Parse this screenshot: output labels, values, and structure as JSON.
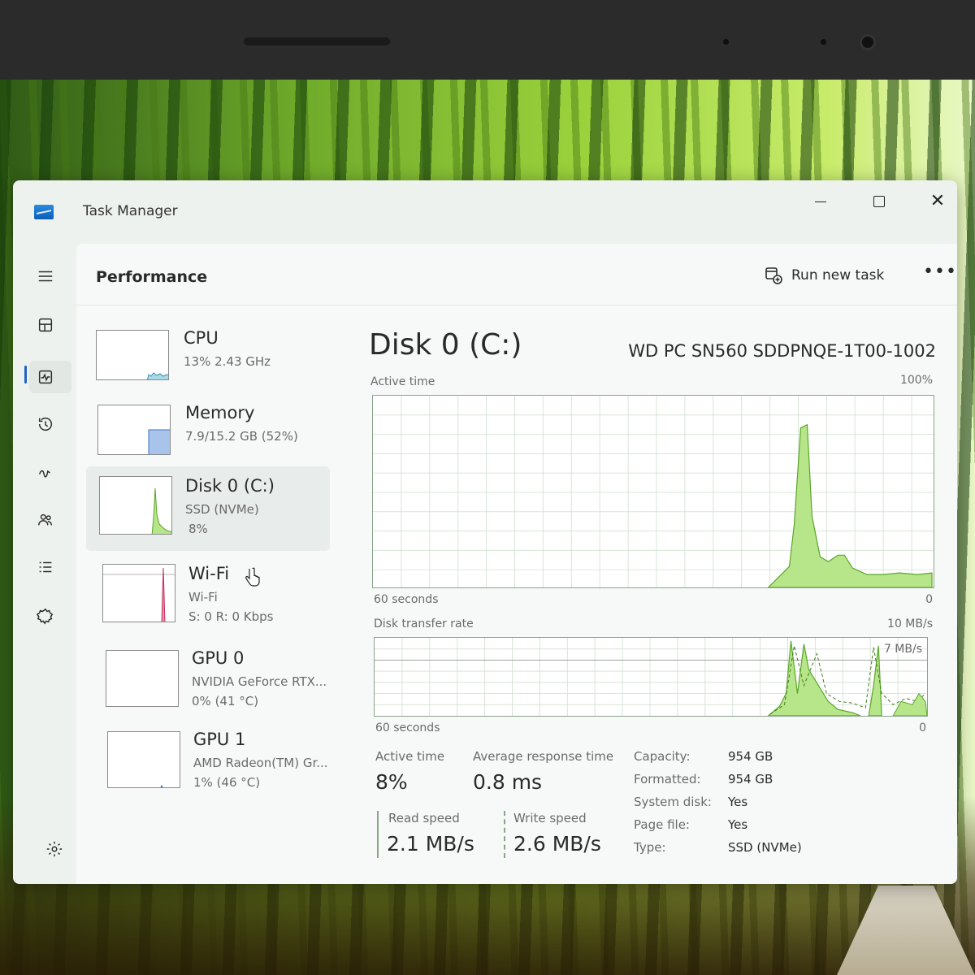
{
  "window": {
    "title": "Task Manager",
    "minimize_icon": "minimize-icon",
    "maximize_icon": "maximize-icon",
    "close_icon": "close-icon"
  },
  "rail": {
    "items": [
      {
        "icon": "hamburger-menu-icon"
      },
      {
        "icon": "processes-icon"
      },
      {
        "icon": "performance-icon"
      },
      {
        "icon": "app-history-icon"
      },
      {
        "icon": "startup-apps-icon"
      },
      {
        "icon": "users-icon"
      },
      {
        "icon": "details-icon"
      },
      {
        "icon": "services-icon"
      }
    ],
    "settings_icon": "gear-icon"
  },
  "header": {
    "title": "Performance",
    "run_new_task": "Run new task",
    "more": "•••"
  },
  "devices": [
    {
      "name": "CPU",
      "line1": "13% 2.43 GHz",
      "line2": ""
    },
    {
      "name": "Memory",
      "line1": "7.9/15.2 GB (52%)",
      "line2": ""
    },
    {
      "name": "Disk 0 (C:)",
      "line1": "SSD (NVMe)",
      "line2": "8%"
    },
    {
      "name": "Wi-Fi",
      "line1": "Wi-Fi",
      "line2": "S: 0 R: 0 Kbps"
    },
    {
      "name": "GPU 0",
      "line1": "NVIDIA GeForce RTX...",
      "line2": "0% (41 °C)"
    },
    {
      "name": "GPU 1",
      "line1": "AMD Radeon(TM) Gr...",
      "line2": "1% (46 °C)"
    }
  ],
  "detail": {
    "title": "Disk 0 (C:)",
    "model": "WD PC SN560 SDDPNQE-1T00-1002",
    "active_graph": {
      "label": "Active time",
      "max": "100%",
      "xlabel": "60 seconds",
      "min": "0"
    },
    "transfer_graph": {
      "label": "Disk transfer rate",
      "max": "10 MB/s",
      "mid": "7 MB/s",
      "xlabel": "60 seconds",
      "min": "0"
    },
    "stats": {
      "active_time_label": "Active time",
      "active_time": "8%",
      "avg_response_label": "Average response time",
      "avg_response": "0.8 ms",
      "read_label": "Read speed",
      "read": "2.1 MB/s",
      "write_label": "Write speed",
      "write": "2.6 MB/s"
    },
    "properties": [
      {
        "key": "Capacity:",
        "value": "954 GB"
      },
      {
        "key": "Formatted:",
        "value": "954 GB"
      },
      {
        "key": "System disk:",
        "value": "Yes"
      },
      {
        "key": "Page file:",
        "value": "Yes"
      },
      {
        "key": "Type:",
        "value": "SSD (NVMe)"
      }
    ]
  },
  "colors": {
    "disk_fill": "#b7e58a",
    "disk_line": "#5aa62a",
    "memory_fill": "#a9c4ea",
    "wifi_line": "#c0305a",
    "accent": "#2262c6"
  }
}
